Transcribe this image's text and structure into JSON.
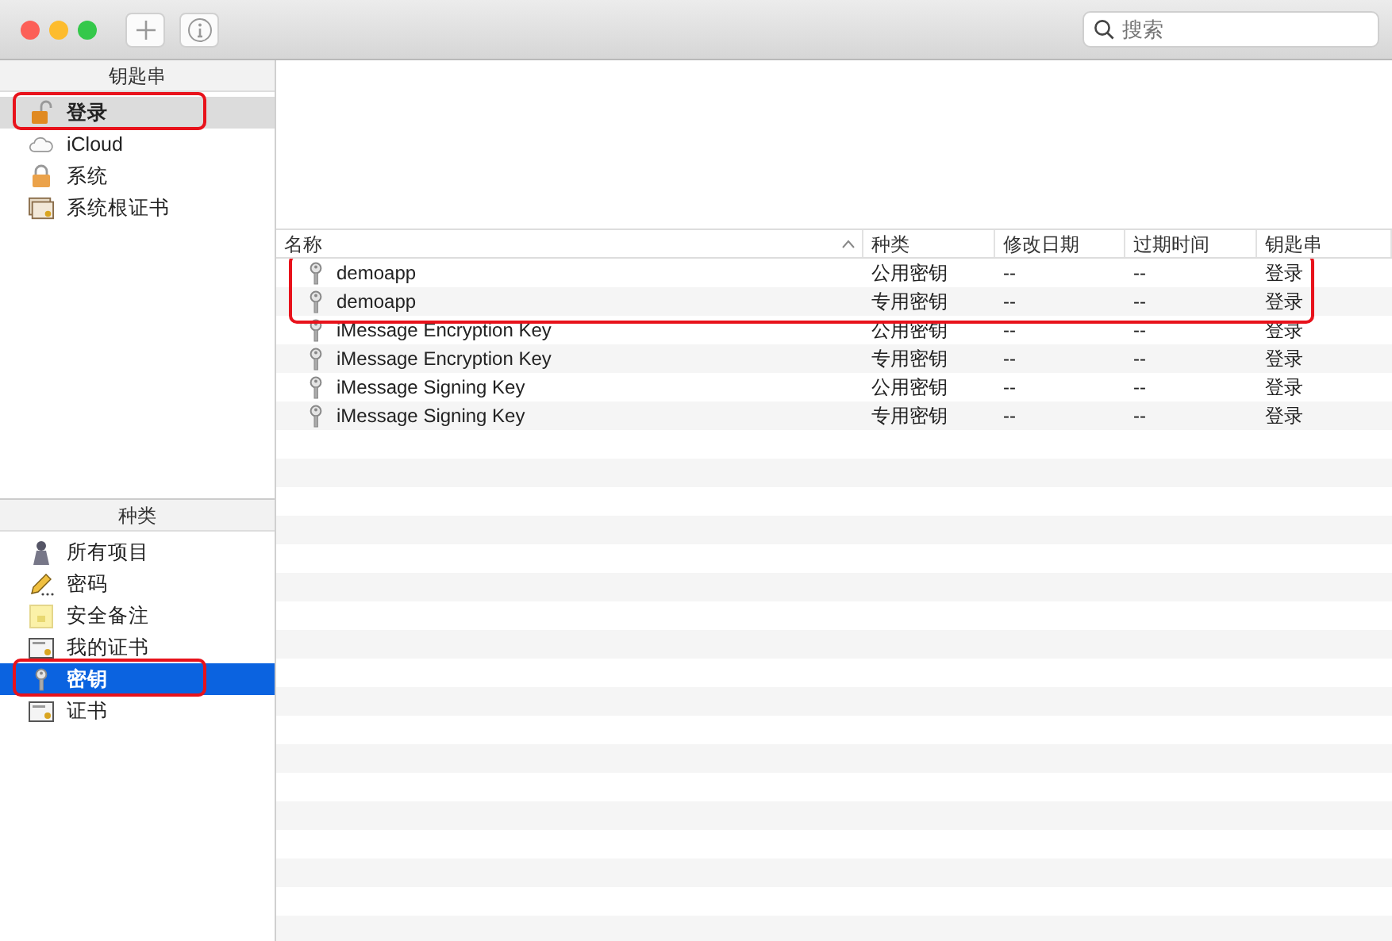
{
  "toolbar": {
    "search": {
      "placeholder": "搜索"
    }
  },
  "keychains": {
    "title": "钥匙串",
    "items": [
      {
        "label": "登录",
        "selected": true,
        "circled": true
      },
      {
        "label": "iCloud",
        "selected": false,
        "circled": false
      },
      {
        "label": "系统",
        "selected": false,
        "circled": false
      },
      {
        "label": "系统根证书",
        "selected": false,
        "circled": false
      }
    ]
  },
  "categories": {
    "title": "种类",
    "items": [
      {
        "label": "所有项目",
        "selected": false,
        "circled": false
      },
      {
        "label": "密码",
        "selected": false,
        "circled": false
      },
      {
        "label": "安全备注",
        "selected": false,
        "circled": false
      },
      {
        "label": "我的证书",
        "selected": false,
        "circled": false
      },
      {
        "label": "密钥",
        "selected": true,
        "circled": true
      },
      {
        "label": "证书",
        "selected": false,
        "circled": false
      }
    ]
  },
  "table": {
    "columns": [
      {
        "label": "名称",
        "sorted": true
      },
      {
        "label": "种类",
        "sorted": false
      },
      {
        "label": "修改日期",
        "sorted": false
      },
      {
        "label": "过期时间",
        "sorted": false
      },
      {
        "label": "钥匙串",
        "sorted": false
      }
    ],
    "rows": [
      {
        "cells": [
          "demoapp",
          "公用密钥",
          "--",
          "--",
          "登录"
        ],
        "circled": true
      },
      {
        "cells": [
          "demoapp",
          "专用密钥",
          "--",
          "--",
          "登录"
        ],
        "circled": true
      },
      {
        "cells": [
          "iMessage Encryption Key",
          "公用密钥",
          "--",
          "--",
          "登录"
        ],
        "circled": false
      },
      {
        "cells": [
          "iMessage Encryption Key",
          "专用密钥",
          "--",
          "--",
          "登录"
        ],
        "circled": false
      },
      {
        "cells": [
          "iMessage Signing Key",
          "公用密钥",
          "--",
          "--",
          "登录"
        ],
        "circled": false
      },
      {
        "cells": [
          "iMessage Signing Key",
          "专用密钥",
          "--",
          "--",
          "登录"
        ],
        "circled": false
      }
    ]
  }
}
